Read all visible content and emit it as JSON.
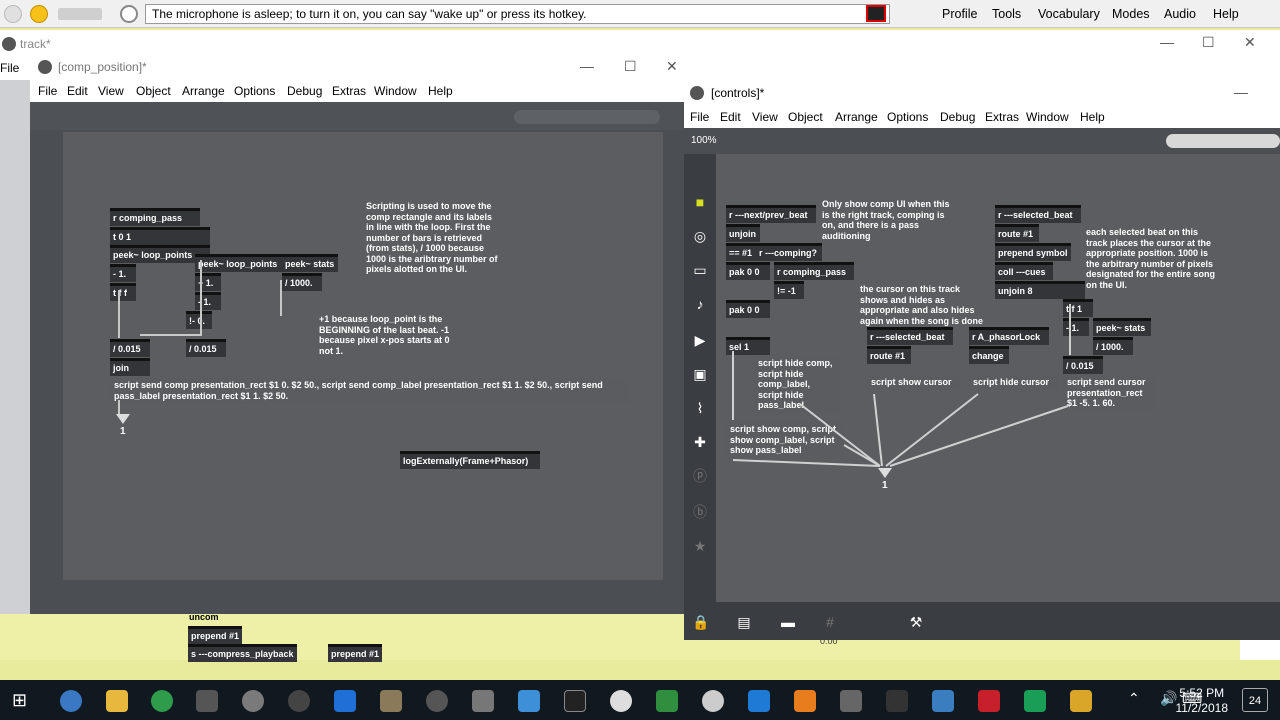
{
  "dragon": {
    "message": "The microphone is asleep; to turn it on, you can say \"wake up\" or press its hotkey.",
    "menu": [
      "Profile",
      "Tools",
      "Vocabulary",
      "Modes",
      "Audio",
      "Help"
    ]
  },
  "track_window": {
    "title": "track*",
    "file_label": "File"
  },
  "comp_window": {
    "title": "[comp_position]*",
    "menu": [
      "File",
      "Edit",
      "View",
      "Object",
      "Arrange",
      "Options",
      "Debug",
      "Extras",
      "Window",
      "Help"
    ],
    "objects": {
      "r_comping_pass": "r comping_pass",
      "t01": "t 0 1",
      "peek_loop_points_a": "peek~ loop_points",
      "minus1": "- 1.",
      "tff": "t f f",
      "peek_loop_points_b": "peek~ loop_points",
      "peek_stats": "peek~ stats",
      "plus1": "+ 1.",
      "minus1b": "- 1.",
      "notminus0": "!- 0.",
      "div1000": "/ 1000.",
      "div015a": "/ 0.015",
      "div015b": "/ 0.015",
      "join": "join",
      "logext": "logExternally(Frame+Phasor)"
    },
    "script_msg": "script send comp presentation_rect $1 0. $2 50., script send comp_label presentation_rect $1 1. $2 50., script send pass_label presentation_rect $1 1. $2 50.",
    "comment_scripting": "Scripting is used to move the comp rectangle and its labels in line with the loop. First the number of bars is retrieved (from stats), / 1000 because 1000 is the aribtrary number of pixels alotted on the UI.",
    "comment_plus1": "+1 because loop_point is the BEGINNING of the last beat. -1 because pixel x-pos starts at 0 not 1.",
    "outlet_num": "1",
    "behind_objects": [
      "uncom",
      "prepend #1",
      "s ---compress_playback",
      "prepend #1"
    ],
    "behind_time": "0:00"
  },
  "controls_window": {
    "title": "[controls]*",
    "menu": [
      "File",
      "Edit",
      "View",
      "Object",
      "Arrange",
      "Options",
      "Debug",
      "Extras",
      "Window",
      "Help"
    ],
    "zoom": "100%",
    "objects": {
      "r_next_prev": "r ---next/prev_beat",
      "unjoin": "unjoin",
      "eq1": "== #1",
      "r_comping": "r ---comping?",
      "pak00a": "pak 0 0",
      "r_comping_pass": "r comping_pass",
      "neq1": "!= -1",
      "pak00b": "pak 0 0",
      "sel1": "sel 1",
      "r_selected_beat_a": "r ---selected_beat",
      "route1a": "route #1",
      "prepend_symbol": "prepend symbol",
      "coll_cues": "coll ---cues",
      "unjoin8": "unjoin 8",
      "tf1": "t f 1",
      "minus1": "- 1.",
      "peek_stats": "peek~ stats",
      "div1000": "/ 1000.",
      "div015": "/ 0.015",
      "r_selected_beat_b": "r ---selected_beat",
      "route1b": "route #1",
      "r_phasorlock": "r A_phasorLock",
      "change": "change"
    },
    "messages": {
      "hide_comp": "script hide comp, script hide comp_label, script hide pass_label",
      "show_comp": "script show comp, script show comp_label, script show pass_label",
      "show_cursor": "script show cursor",
      "hide_cursor": "script hide cursor",
      "send_cursor": "script send cursor presentation_rect $1 -5. 1. 60."
    },
    "comments": {
      "only_show": "Only show comp UI when this is the right track, comping is on, and there is a pass auditioning",
      "cursor_track": "the cursor on this track shows and hides as appropriate and also hides again when the song is done",
      "each_selected": "each selected beat on this track places the cursor at the appropriate position. 1000 is the arbitrary number of pixels designated for the entire song on the UI."
    },
    "outlet_num": "1"
  },
  "taskbar": {
    "time": "5:52 PM",
    "date": "11/2/2018",
    "notif": "24"
  }
}
